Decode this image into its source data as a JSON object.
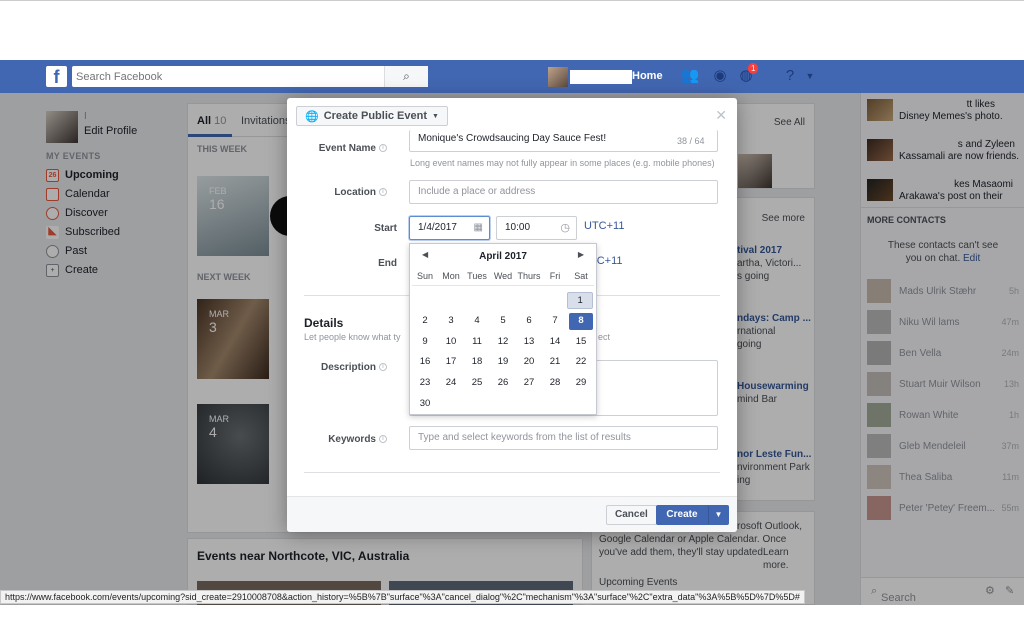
{
  "topnav": {
    "search_placeholder": "Search Facebook",
    "logo": "f",
    "home_label": "Home",
    "notifications_count": "1"
  },
  "leftnav": {
    "profile_name": "I",
    "edit_profile": "Edit Profile",
    "section": "MY EVENTS",
    "items": [
      {
        "label": "Upcoming",
        "icon": "calendar-26-icon"
      },
      {
        "label": "Calendar",
        "icon": "calendar-icon"
      },
      {
        "label": "Discover",
        "icon": "compass-icon"
      },
      {
        "label": "Subscribed",
        "icon": "rss-icon"
      },
      {
        "label": "Past",
        "icon": "clock-icon"
      },
      {
        "label": "Create",
        "icon": "plus-icon"
      }
    ],
    "upcoming_icon_text": "26"
  },
  "center": {
    "tabs": [
      {
        "label": "All",
        "count": "10"
      },
      {
        "label": "Invitations"
      }
    ],
    "this_week": "THIS WEEK",
    "next_week": "NEXT WEEK",
    "events": [
      {
        "month": "FEB",
        "day": "16"
      },
      {
        "month": "MAR",
        "day": "3"
      },
      {
        "month": "MAR",
        "day": "4"
      }
    ],
    "near_title": "Events near Northcote, VIC, Australia"
  },
  "right": {
    "see_all": "See All",
    "see_more": "See more",
    "item1_title": "tival 2017",
    "item1_text": "artha, Victori...",
    "item1_sub": "s going",
    "item2_title": "ndays: Camp ...",
    "item2_text": "rnational",
    "item2_sub": "going",
    "item3_title": "Housewarming",
    "item3_text": "mind Bar",
    "item4_title": "nor Leste Fun...",
    "item4_text": "nvironment Park",
    "item4_sub": "ing",
    "bottom_text_1": "rosoft Outlook,",
    "bottom_text_2": "Google Calendar or Apple Calendar. Once",
    "bottom_text_3": "you've add them, they'll stay updated.",
    "learn_more": "Learn more.",
    "upcoming_events": "Upcoming Events"
  },
  "sidebar": {
    "ticker": [
      {
        "line1": "tt likes",
        "line2": "Disney Memes's photo."
      },
      {
        "line1": "s and Zyleen",
        "line2": "Kassamali are now friends."
      },
      {
        "line1": "kes Masaomi",
        "line2": "Arakawa's post on their"
      }
    ],
    "more_contacts": "MORE CONTACTS",
    "note": "These contacts can't see you on chat.",
    "note_edit": "Edit",
    "contacts": [
      {
        "name": "Mads Ulrik Stæhr",
        "time": "5h"
      },
      {
        "name": "Niku Wil lams",
        "time": "47m"
      },
      {
        "name": "Ben Vella",
        "time": "24m"
      },
      {
        "name": "Stuart Muir Wilson",
        "time": "13h"
      },
      {
        "name": "Rowan White",
        "time": "1h"
      },
      {
        "name": "Gleb Mendeleil",
        "time": "37m"
      },
      {
        "name": "Thea Saliba",
        "time": "11m"
      },
      {
        "name": "Peter 'Petey' Freem...",
        "time": "55m"
      }
    ],
    "search_placeholder": "Search"
  },
  "modal": {
    "event_type": "Create Public Event",
    "event_name_label": "Event Name",
    "event_name_value": "Monique's Crowdsaucing Day Sauce Fest!",
    "event_name_count": "38 / 64",
    "event_name_hint": "Long event names may not fully appear in some places (e.g. mobile phones)",
    "location_label": "Location",
    "location_placeholder": "Include a place or address",
    "start_label": "Start",
    "start_date": "1/4/2017",
    "start_time": "10:00",
    "timezone": "UTC+11",
    "end_label": "End",
    "end_timezone": "TC+11",
    "details_title": "Details",
    "details_sub": "Let people know what ty",
    "details_sub_tail": "ect",
    "description_label": "Description",
    "keywords_label": "Keywords",
    "keywords_placeholder": "Type and select keywords from the list of results",
    "cancel": "Cancel",
    "create": "Create"
  },
  "calendar": {
    "title": "April 2017",
    "dows": [
      "Sun",
      "Mon",
      "Tues",
      "Wed",
      "Thurs",
      "Fri",
      "Sat"
    ],
    "weeks": [
      [
        "",
        "",
        "",
        "",
        "",
        "",
        "1"
      ],
      [
        "2",
        "3",
        "4",
        "5",
        "6",
        "7",
        "8"
      ],
      [
        "9",
        "10",
        "11",
        "12",
        "13",
        "14",
        "15"
      ],
      [
        "16",
        "17",
        "18",
        "19",
        "20",
        "21",
        "22"
      ],
      [
        "23",
        "24",
        "25",
        "26",
        "27",
        "28",
        "29"
      ],
      [
        "30",
        "",
        "",
        "",
        "",
        "",
        ""
      ]
    ],
    "selected": "8",
    "first_highlight": "1"
  },
  "statusbar": {
    "url": "https://www.facebook.com/events/upcoming?sid_create=2910008708&action_history=%5B%7B\"surface\"%3A\"cancel_dialog\"%2C\"mechanism\"%3A\"surface\"%2C\"extra_data\"%3A%5B%5D%7D%5D#"
  }
}
